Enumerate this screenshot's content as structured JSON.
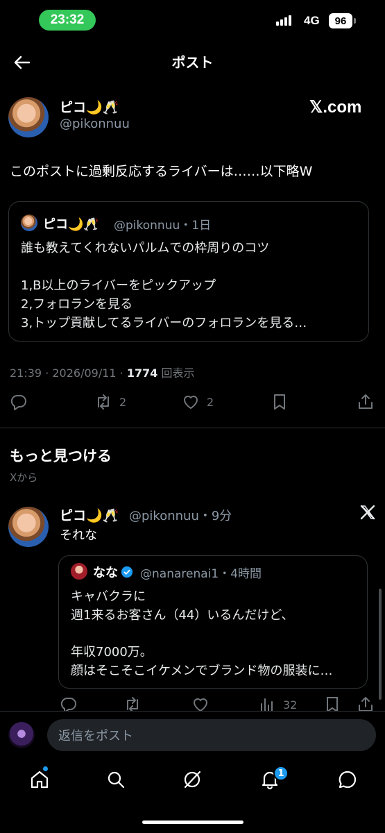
{
  "status_bar": {
    "time": "23:32",
    "network": "4G",
    "battery": "96"
  },
  "header": {
    "title": "ポスト"
  },
  "post": {
    "author_name": "ピコ🌙🥂",
    "handle": "@pikonnuu",
    "source_label": "𝕏.com",
    "text": "このポストに過剰反応するライバーは……以下略W",
    "quote": {
      "author_name": "ピコ🌙🥂",
      "handle": "@pikonnuu",
      "time": "・1日",
      "lines": [
        "誰も教えてくれないパルムでの枠周りのコツ",
        "",
        "1,B以上のライバーをピックアップ",
        "2,フォロランを見る",
        "3,トップ貢献してるライバーのフォロランを見る…"
      ]
    },
    "timestamp": "21:39 · 2026/09/11 · ",
    "views_count": "1774",
    "views_label": " 回表示",
    "retweets": "2",
    "likes": "2"
  },
  "discover": {
    "title": "もっと見つける",
    "subtitle": "Xから",
    "item": {
      "author_name": "ピコ🌙🥂",
      "handle": "@pikonnuu",
      "time": "・9分",
      "text": "それな",
      "quote": {
        "author_name": "なな",
        "handle": "@nanarenai1",
        "time": "・4時間",
        "lines": [
          "キャバクラに",
          "週1来るお客さん（44）いるんだけど、",
          "",
          "年収7000万。",
          "顔はそこそこイケメンでブランド物の服装に…"
        ]
      },
      "views": "32"
    }
  },
  "reply": {
    "placeholder": "返信をポスト"
  },
  "tabbar": {
    "notification_badge": "1"
  },
  "colors": {
    "background": "#000000",
    "text": "#e7e9ea",
    "muted": "#71767b",
    "verified": "#1d9bf0",
    "status_time_pill": "#34c759"
  }
}
